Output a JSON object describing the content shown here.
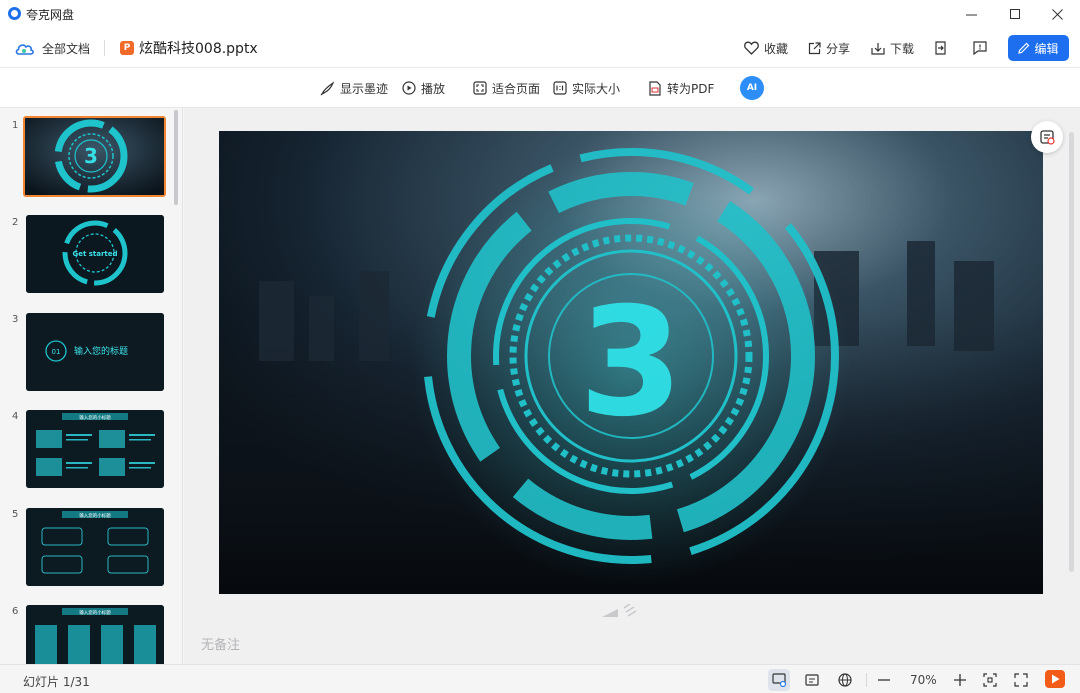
{
  "window": {
    "app_title": "夸克网盘"
  },
  "header": {
    "breadcrumb_all": "全部文档",
    "doc_icon_letter": "P",
    "doc_name": "炫酷科技008.pptx",
    "favorite_label": "收藏",
    "share_label": "分享",
    "download_label": "下载",
    "edit_label": "编辑"
  },
  "toolbar": {
    "show_ink_label": "显示墨迹",
    "play_label": "播放",
    "fit_page_label": "适合页面",
    "actual_size_label": "实际大小",
    "to_pdf_label": "转为PDF",
    "ai_label": "AI"
  },
  "thumbnails": {
    "numbers": [
      "1",
      "2",
      "3",
      "4",
      "5",
      "6"
    ],
    "selected": 1,
    "slide2_text": "Get started",
    "slide3_num": "01",
    "slide3_text": "输入您的标题",
    "slide4_title": "输入您的小标题",
    "slide5_title": "输入您的小标题",
    "slide6_title": "输入您的小标题"
  },
  "main": {
    "slide_number_text": "3",
    "notes_placeholder": "无备注"
  },
  "status": {
    "slide_counter": "幻灯片 1/31",
    "zoom": "70%"
  },
  "colors": {
    "accent": "#1e6ff0",
    "teal": "#1fb8c4",
    "selected_border": "#f18532",
    "play_orange": "#f35c18"
  },
  "icons": [
    "cloud-icon",
    "heart-icon",
    "share-icon",
    "download-icon",
    "export-icon",
    "feedback-icon",
    "pencil-icon",
    "pen-icon",
    "play-icon",
    "fit-icon",
    "actual-size-icon",
    "pdf-icon",
    "minimize-icon",
    "maximize-icon",
    "close-icon",
    "zoom-in-icon",
    "zoom-out-icon",
    "fullscreen-icon"
  ]
}
